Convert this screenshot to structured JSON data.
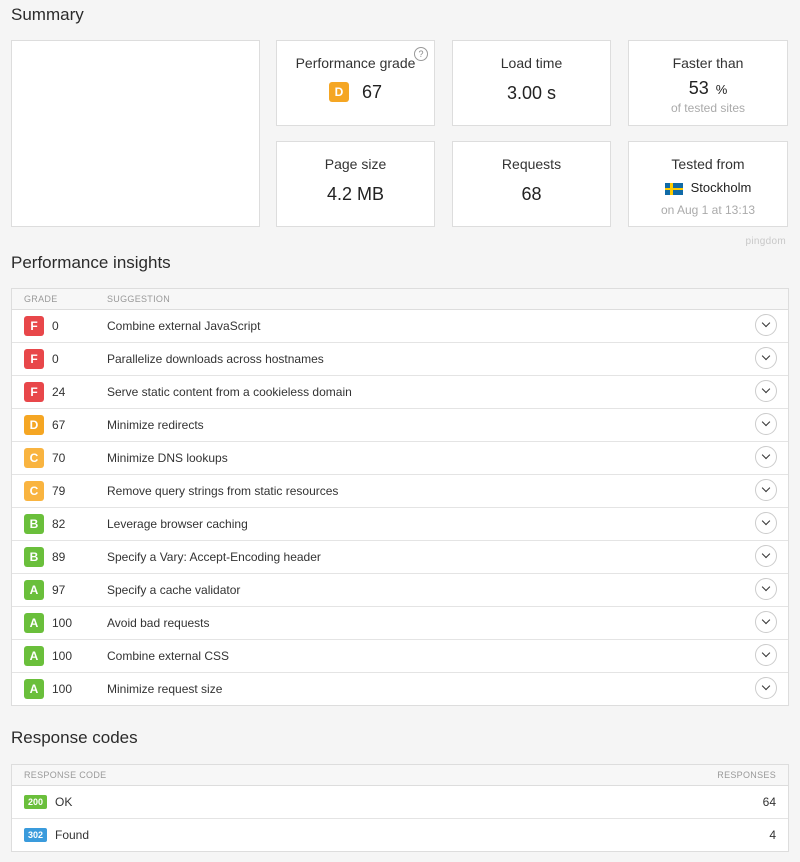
{
  "summary": {
    "title": "Summary",
    "performance_grade": {
      "label": "Performance grade",
      "grade": "D",
      "score": "67",
      "help": "?"
    },
    "load_time": {
      "label": "Load time",
      "value": "3.00 s"
    },
    "faster_than": {
      "label": "Faster than",
      "value": "53",
      "unit": "%",
      "sub": "of tested sites"
    },
    "page_size": {
      "label": "Page size",
      "value": "4.2 MB"
    },
    "requests": {
      "label": "Requests",
      "value": "68"
    },
    "tested_from": {
      "label": "Tested from",
      "location": "Stockholm",
      "sub": "on Aug 1 at 13:13"
    },
    "brand": "pingdom"
  },
  "insights": {
    "title": "Performance insights",
    "headers": {
      "grade": "GRADE",
      "suggestion": "SUGGESTION"
    },
    "rows": [
      {
        "grade": "F",
        "score": "0",
        "suggestion": "Combine external JavaScript"
      },
      {
        "grade": "F",
        "score": "0",
        "suggestion": "Parallelize downloads across hostnames"
      },
      {
        "grade": "F",
        "score": "24",
        "suggestion": "Serve static content from a cookieless domain"
      },
      {
        "grade": "D",
        "score": "67",
        "suggestion": "Minimize redirects"
      },
      {
        "grade": "C",
        "score": "70",
        "suggestion": "Minimize DNS lookups"
      },
      {
        "grade": "C",
        "score": "79",
        "suggestion": "Remove query strings from static resources"
      },
      {
        "grade": "B",
        "score": "82",
        "suggestion": "Leverage browser caching"
      },
      {
        "grade": "B",
        "score": "89",
        "suggestion": "Specify a Vary: Accept-Encoding header"
      },
      {
        "grade": "A",
        "score": "97",
        "suggestion": "Specify a cache validator"
      },
      {
        "grade": "A",
        "score": "100",
        "suggestion": "Avoid bad requests"
      },
      {
        "grade": "A",
        "score": "100",
        "suggestion": "Combine external CSS"
      },
      {
        "grade": "A",
        "score": "100",
        "suggestion": "Minimize request size"
      }
    ]
  },
  "responses": {
    "title": "Response codes",
    "headers": {
      "code": "RESPONSE CODE",
      "count": "RESPONSES"
    },
    "rows": [
      {
        "code": "200",
        "text": "OK",
        "count": "64"
      },
      {
        "code": "302",
        "text": "Found",
        "count": "4"
      }
    ]
  },
  "colors": {
    "grade_F": "#e8474a",
    "grade_D": "#f5a623",
    "grade_C": "#f9b440",
    "grade_B": "#6abf3b",
    "grade_A": "#6abf3b",
    "code_200": "#6abf3b",
    "code_302": "#3a9bdc"
  }
}
